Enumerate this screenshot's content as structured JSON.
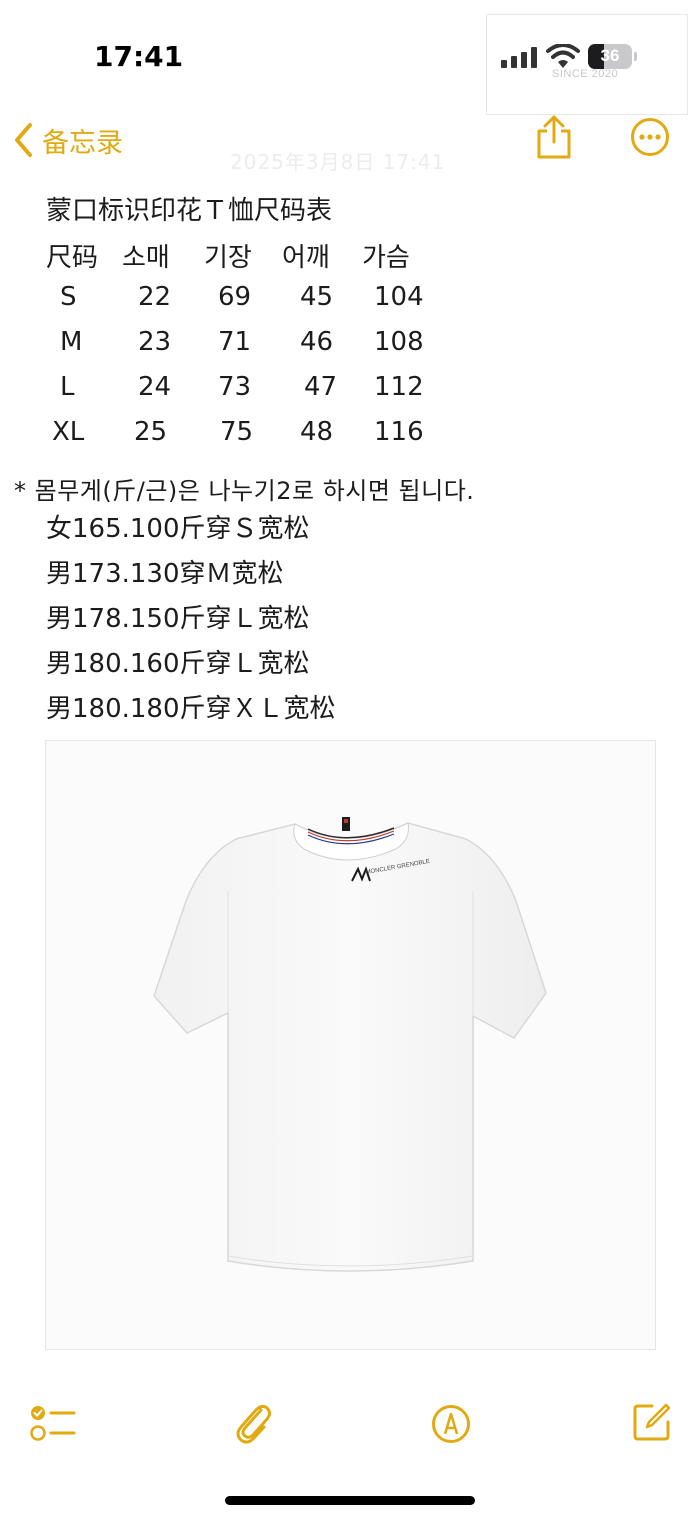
{
  "status_bar": {
    "time": "17:41",
    "battery_level": "36",
    "watermark": "SINCE 2020"
  },
  "nav": {
    "back_label": "备忘录"
  },
  "note": {
    "date_ghost": "2025年3月8日 17:41",
    "title": "蒙口标识印花Ｔ恤尺码表",
    "table": {
      "headers": [
        "尺码",
        "소매",
        "기장",
        "어깨",
        "가슴"
      ],
      "rows": [
        [
          "S",
          "22",
          "69",
          "45",
          "104"
        ],
        [
          "M",
          "23",
          "71",
          "46",
          "108"
        ],
        [
          "L",
          "24",
          "73",
          "47",
          "112"
        ],
        [
          "XL",
          "25",
          "75",
          "48",
          "116"
        ]
      ]
    },
    "weight_note": "* 몸무게(斤/근)은 나누기2로 하시면 됩니다.",
    "recommendations": [
      "女165.100斤穿Ｓ宽松",
      "男173.130穿Ｍ宽松",
      "男178.150斤穿Ｌ宽松",
      "男180.160斤穿Ｌ宽松",
      "男180.180斤穿ＸＬ宽松"
    ]
  },
  "photo": {
    "alt": "white t-shirt",
    "collar_text": "MONCLER GRENOBLE"
  },
  "colors": {
    "accent": "#e1a912",
    "text": "#1c1c1e"
  },
  "toolbar": {
    "icons": [
      "checklist-icon",
      "paperclip-icon",
      "markup-pen-icon",
      "compose-icon"
    ]
  }
}
